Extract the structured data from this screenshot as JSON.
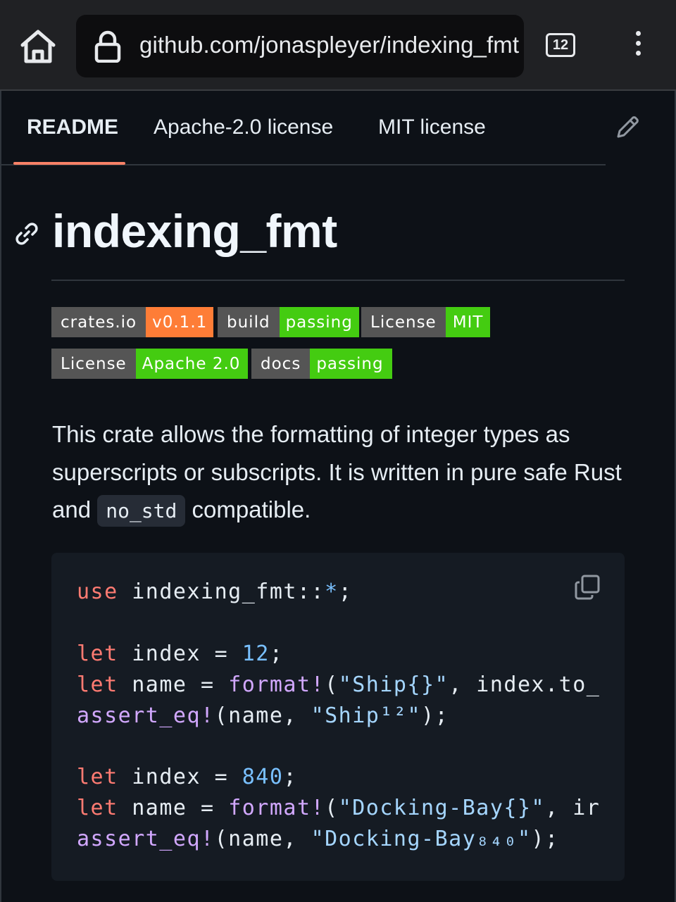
{
  "browser": {
    "url": "github.com/jonaspleyer/indexing_fmt",
    "tab_count": "12"
  },
  "readme_tabs": [
    {
      "label": "README",
      "active": true
    },
    {
      "label": "Apache-2.0 license",
      "active": false
    },
    {
      "label": "MIT license",
      "active": false
    }
  ],
  "heading": "indexing_fmt",
  "badges": [
    {
      "left": "crates.io",
      "right": "v0.1.1",
      "right_color": "#fe7d37"
    },
    {
      "left": "build",
      "right": "passing",
      "right_color": "#44cc11"
    },
    {
      "left": "License",
      "right": "MIT",
      "right_color": "#44cc11"
    },
    {
      "left": "License",
      "right": "Apache 2.0",
      "right_color": "#44cc11"
    },
    {
      "left": "docs",
      "right": "passing",
      "right_color": "#44cc11"
    }
  ],
  "description": {
    "before": "This crate allows the formatting of integer types as superscripts or subscripts. It is written in pure safe Rust and ",
    "code": "no_std",
    "after": " compatible."
  },
  "code": {
    "l1": {
      "kw": "use",
      "rest": " indexing_fmt::",
      "star": "*",
      "end": ";"
    },
    "l2": {
      "kw": "let",
      "mid": " index = ",
      "num": "12",
      "end": ";"
    },
    "l3": {
      "kw": "let",
      "mid": " name = ",
      "mac": "format!",
      "open": "(",
      "str": "\"Ship{}\"",
      "rest": ", index.to_"
    },
    "l4": {
      "mac": "assert_eq!",
      "mid": "(name, ",
      "str": "\"Ship¹²\"",
      "end": ");"
    },
    "l5": {
      "kw": "let",
      "mid": " index = ",
      "num": "840",
      "end": ";"
    },
    "l6": {
      "kw": "let",
      "mid": " name = ",
      "mac": "format!",
      "open": "(",
      "str": "\"Docking-Bay{}\"",
      "rest": ", ir"
    },
    "l7": {
      "mac": "assert_eq!",
      "mid": "(name, ",
      "str": "\"Docking-Bay₈₄₀\"",
      "end": ");"
    }
  },
  "colors": {
    "background": "#0d1117",
    "tab_underline": "#f78166",
    "keyword": "#ff7b72",
    "number": "#79c0ff",
    "macro": "#d2a8ff",
    "string": "#a5d6ff"
  },
  "icons": [
    "home-icon",
    "lock-icon",
    "more-vert-icon",
    "pencil-icon",
    "link-icon",
    "copy-icon"
  ]
}
